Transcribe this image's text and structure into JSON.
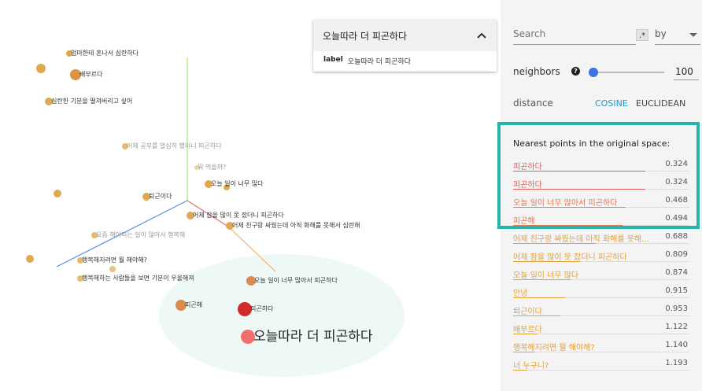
{
  "canvas": {
    "points": [
      {
        "id": "p1",
        "label": "엄마한테 혼나서 심란하다",
        "faded": false,
        "big": false,
        "color": "#e0a951"
      },
      {
        "id": "p2",
        "label": "",
        "faded": false,
        "big": false,
        "color": "#e0a951"
      },
      {
        "id": "p3",
        "label": "배부르다",
        "faded": false,
        "big": false,
        "color": "#d9953f"
      },
      {
        "id": "p4",
        "label": "심란한 기분을 떨쳐버리고 싶어",
        "faded": false,
        "big": false,
        "color": "#e0a951"
      },
      {
        "id": "p5",
        "label": "어제 공부를 열심히 했더니 피곤하다",
        "faded": true,
        "big": false,
        "color": "#e8bb6c"
      },
      {
        "id": "p6",
        "label": "뭐 먹을까?",
        "faded": true,
        "big": false,
        "color": "#f0d59a"
      },
      {
        "id": "p7",
        "label": "오늘 일이 너무 많다",
        "faded": false,
        "big": false,
        "color": "#e0a951"
      },
      {
        "id": "p8",
        "label": "",
        "faded": false,
        "big": false,
        "color": "#e0a951"
      },
      {
        "id": "p9",
        "label": "퇴근이다",
        "faded": false,
        "big": false,
        "color": "#e0a951"
      },
      {
        "id": "p10",
        "label": "어제 잠을 많이 못 잤더니 피곤하다",
        "faded": false,
        "big": false,
        "color": "#e0a951"
      },
      {
        "id": "p11",
        "label": "어제 친구랑 싸웠는데 아직 화해를 못해서 심란해",
        "faded": false,
        "big": false,
        "color": "#e0a951"
      },
      {
        "id": "p12",
        "label": "요즘 해야되는 일이 많아서 행복해",
        "faded": true,
        "big": false,
        "color": "#e8bb6c"
      },
      {
        "id": "p13",
        "label": "",
        "faded": false,
        "big": false,
        "color": "#e0a951"
      },
      {
        "id": "p14",
        "label": "행복해지려면 뭘 해야해?",
        "faded": false,
        "big": false,
        "color": "#e8bb6c"
      },
      {
        "id": "p15",
        "label": "",
        "faded": false,
        "big": false,
        "color": "#e8c680"
      },
      {
        "id": "p16",
        "label": "",
        "faded": false,
        "big": false,
        "color": "#e0a951"
      },
      {
        "id": "p17",
        "label": "행복해하는 사람들을 보면 기분이 우울해져",
        "faded": false,
        "big": false,
        "color": "#e8bb6c"
      },
      {
        "id": "p18",
        "label": "오늘 일이 너무 많아서 피곤하다",
        "faded": false,
        "big": false,
        "color": "#d98a4c"
      },
      {
        "id": "p19",
        "label": "피곤해",
        "faded": false,
        "big": false,
        "color": "#d98a4c"
      },
      {
        "id": "p20",
        "label": "피곤하다",
        "faded": false,
        "big": false,
        "color": "#d32b2b"
      },
      {
        "id": "p21",
        "label": "오늘따라 더 피곤하다",
        "faded": false,
        "big": true,
        "color": "#ef6f6f"
      }
    ]
  },
  "info_card": {
    "title": "오늘따라 더 피곤하다",
    "field_key": "label",
    "field_value": "오늘따라 더 피곤하다",
    "collapse_icon": "chevron-up-icon"
  },
  "panel": {
    "search_placeholder": "Search",
    "regex_label": ".*",
    "by_label": "by",
    "neighbors_label": "neighbors",
    "neighbors_value": "100",
    "neighbors_fraction": 0.04,
    "distance_label": "distance",
    "distance_options": [
      {
        "label": "COSINE",
        "active": true
      },
      {
        "label": "EUCLIDEAN",
        "active": false
      }
    ],
    "nearest_title": "Nearest points in the original space:",
    "nearest": [
      {
        "label": "피곤하다",
        "value": "0.324",
        "color": "#e05a5a"
      },
      {
        "label": "피곤하다",
        "value": "0.324",
        "color": "#e05a5a"
      },
      {
        "label": "오늘 일이 너무 많아서 피곤하다",
        "value": "0.468",
        "color": "#e07a5a"
      },
      {
        "label": "피곤해",
        "value": "0.494",
        "color": "#e07a5a"
      },
      {
        "label": "어제 친구랑 싸웠는데 아직 화해를 못해...",
        "value": "0.688",
        "color": "#e0a040"
      },
      {
        "label": "어제 잠을 많이 못 잤더니 피곤하다",
        "value": "0.809",
        "color": "#e0a040"
      },
      {
        "label": "오늘 일이 너무 많다",
        "value": "0.874",
        "color": "#e0a040"
      },
      {
        "label": "안녕",
        "value": "0.915",
        "color": "#e0a040"
      },
      {
        "label": "퇴근이다",
        "value": "0.953",
        "color": "#e0a040"
      },
      {
        "label": "배부르다",
        "value": "1.122",
        "color": "#e0a040"
      },
      {
        "label": "행복해지려면 뭘 해야해?",
        "value": "1.140",
        "color": "#e0a040"
      },
      {
        "label": "너 누구니?",
        "value": "1.193",
        "color": "#e0a040"
      }
    ]
  },
  "colors": {
    "highlight_border": "#26b5a9",
    "accent": "#2196c8",
    "slider": "#3b73e4"
  }
}
